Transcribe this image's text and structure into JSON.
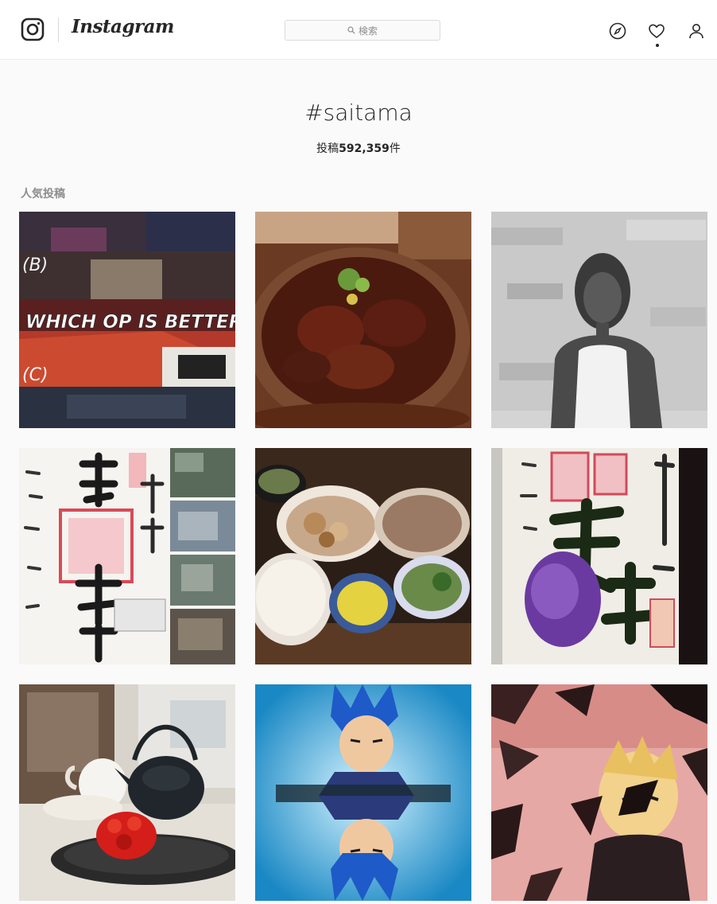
{
  "app": {
    "wordmark": "Instagram",
    "logo_icon": "camera-glyph-icon"
  },
  "search": {
    "placeholder": "検索",
    "icon": "search-icon"
  },
  "nav": {
    "icons": [
      "compass-icon",
      "heart-icon",
      "profile-icon"
    ]
  },
  "hashtag": {
    "title": "#saitama",
    "count_prefix": "投稿",
    "count_value": "592,359",
    "count_suffix": "件"
  },
  "section": {
    "top_posts_label": "人気投稿"
  },
  "posts": [
    {
      "subject": "anime comparison collage",
      "overlay_labels": [
        "(B)",
        "WHICH OP IS BETTER?",
        "(C)"
      ]
    },
    {
      "subject": "grilled meat rice bowl"
    },
    {
      "subject": "man in raglan shirt against brick wall"
    },
    {
      "subject": "shrine stamp calligraphy with photos"
    },
    {
      "subject": "japanese set meal with soba"
    },
    {
      "subject": "shrine stamp with purple seal"
    },
    {
      "subject": "iron teapot and strawberry dessert"
    },
    {
      "subject": "blue-haired anime character mirrored",
      "caption_bar": ""
    },
    {
      "subject": "anime character with shattered glass"
    }
  ],
  "colors": {
    "background": "#fafafa",
    "topbar": "#ffffff",
    "text": "#262626",
    "muted": "#8e8e8e",
    "border": "#dbdbdb"
  }
}
